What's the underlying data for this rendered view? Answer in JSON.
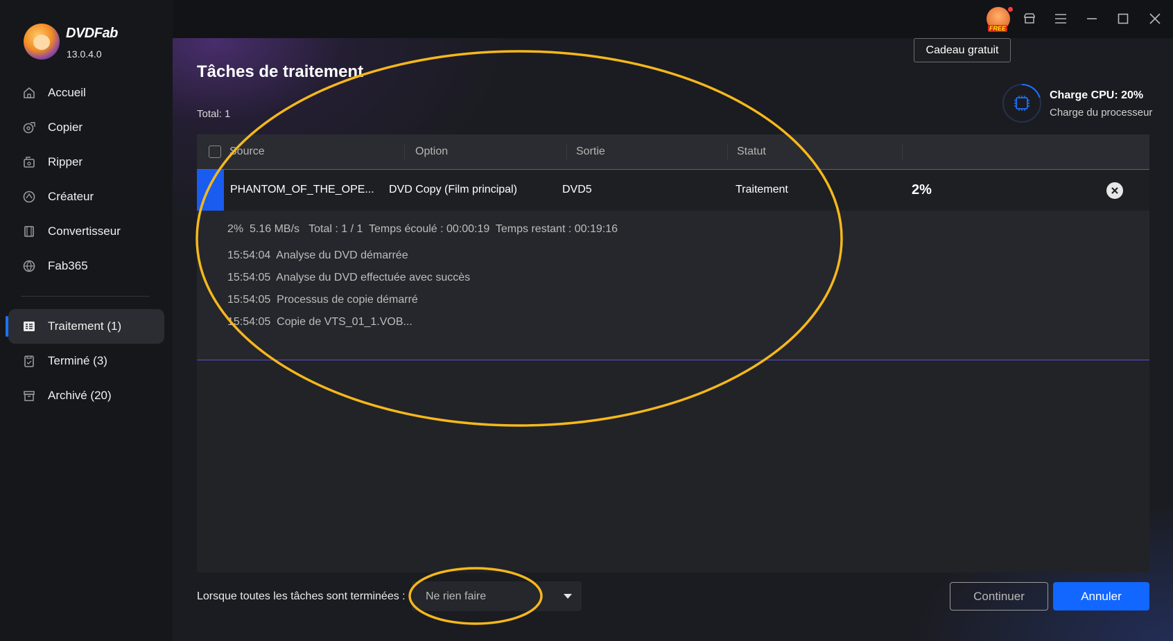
{
  "app": {
    "brand": "DVDFab",
    "version": "13.0.4.0"
  },
  "sidebar": {
    "items": [
      {
        "label": "Accueil",
        "icon": "home-icon"
      },
      {
        "label": "Copier",
        "icon": "copy-icon"
      },
      {
        "label": "Ripper",
        "icon": "ripper-icon"
      },
      {
        "label": "Créateur",
        "icon": "creator-icon"
      },
      {
        "label": "Convertisseur",
        "icon": "converter-icon"
      },
      {
        "label": "Fab365",
        "icon": "fab365-icon"
      }
    ],
    "queue": [
      {
        "label": "Traitement (1)",
        "icon": "processing-icon",
        "active": true
      },
      {
        "label": "Terminé (3)",
        "icon": "finished-icon",
        "active": false
      },
      {
        "label": "Archivé (20)",
        "icon": "archive-icon",
        "active": false
      }
    ]
  },
  "titlebar": {
    "free_badge": "FREE",
    "tooltip": "Cadeau gratuit"
  },
  "page": {
    "title": "Tâches de traitement",
    "total": "Total: 1"
  },
  "cpu": {
    "title": "Charge CPU: 20%",
    "subtitle": "Charge du processeur",
    "load": 0.2
  },
  "table": {
    "headers": [
      "Source",
      "Option",
      "Sortie",
      "Statut"
    ],
    "task": {
      "source": "PHANTOM_OF_THE_OPE...",
      "option": "DVD Copy (Film principal)",
      "output": "DVD5",
      "status": "Traitement",
      "percent": "2%"
    },
    "stats": "2%  5.16 MB/s   Total : 1 / 1  Temps écoulé : 00:00:19  Temps restant : 00:19:16",
    "log": [
      "15:54:04  Analyse du DVD démarrée",
      "15:54:05  Analyse du DVD effectuée avec succès",
      "15:54:05  Processus de copie démarré",
      "15:54:05  Copie de VTS_01_1.VOB..."
    ]
  },
  "footer": {
    "label": "Lorsque toutes les tâches sont terminées :",
    "select_value": "Ne rien faire",
    "continue": "Continuer",
    "cancel": "Annuler"
  },
  "colors": {
    "accent": "#1167ff",
    "annotation": "#f5b81c",
    "row_marker": "#1a5cf0"
  }
}
